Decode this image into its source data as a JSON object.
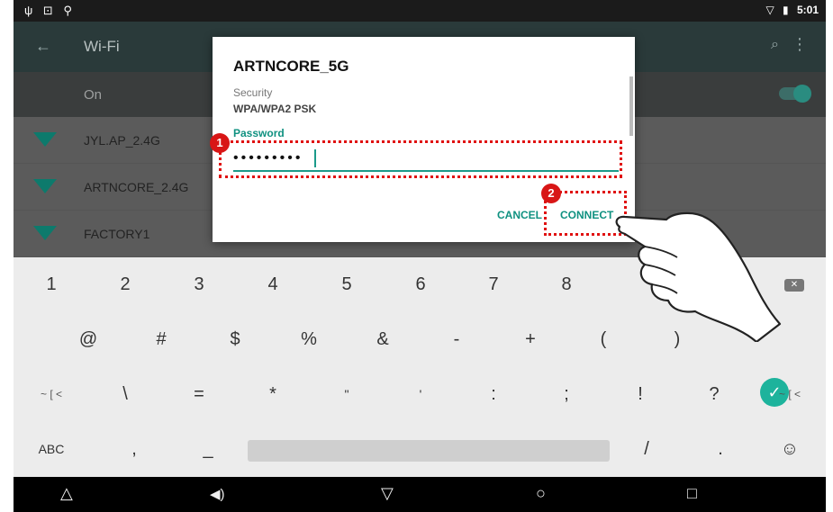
{
  "status_bar": {
    "left_icons": [
      "usb-icon",
      "lock-icon",
      "location-icon"
    ],
    "left_glyphs": "ψ ⊡ ⚲",
    "wifi_glyph": "▽",
    "battery_glyph": "▮",
    "time": "5:01"
  },
  "app": {
    "title": "Wi-Fi",
    "back_glyph": "←",
    "search_glyph": "⌕",
    "more_glyph": "⋮",
    "on_label": "On",
    "networks": [
      {
        "name": "JYL.AP_2.4G"
      },
      {
        "name": "ARTNCORE_2.4G"
      },
      {
        "name": "FACTORY1"
      }
    ]
  },
  "dialog": {
    "title": "ARTNCORE_5G",
    "security_label": "Security",
    "security_value": "WPA/WPA2 PSK",
    "password_label": "Password",
    "password_value": "•••••••••",
    "cancel_label": "CANCEL",
    "connect_label": "CONNECT"
  },
  "annotations": {
    "step1": "1",
    "step2": "2",
    "color": "#e01010"
  },
  "keyboard": {
    "row1": [
      "1",
      "2",
      "3",
      "4",
      "5",
      "6",
      "7",
      "8"
    ],
    "row2": [
      "@",
      "#",
      "$",
      "%",
      "&",
      "-",
      "+",
      "(",
      ")"
    ],
    "row3": [
      "~ [ <",
      "\\",
      "=",
      "*",
      "\"",
      "'",
      ":",
      ";",
      "!",
      "?",
      "~ [ <"
    ],
    "row4": {
      "abc": "ABC",
      "comma": ",",
      "underscore": "_",
      "slash": "/",
      "period": ".",
      "emoji": "☺"
    },
    "backspace_glyph": "✕",
    "enter_glyph": "✓",
    "accent_color": "#1db39c"
  },
  "navbar": {
    "back_glyph": "△",
    "volume_glyph": "◀)",
    "home_down_glyph": "▽",
    "home_glyph": "○",
    "recents_glyph": "□"
  }
}
